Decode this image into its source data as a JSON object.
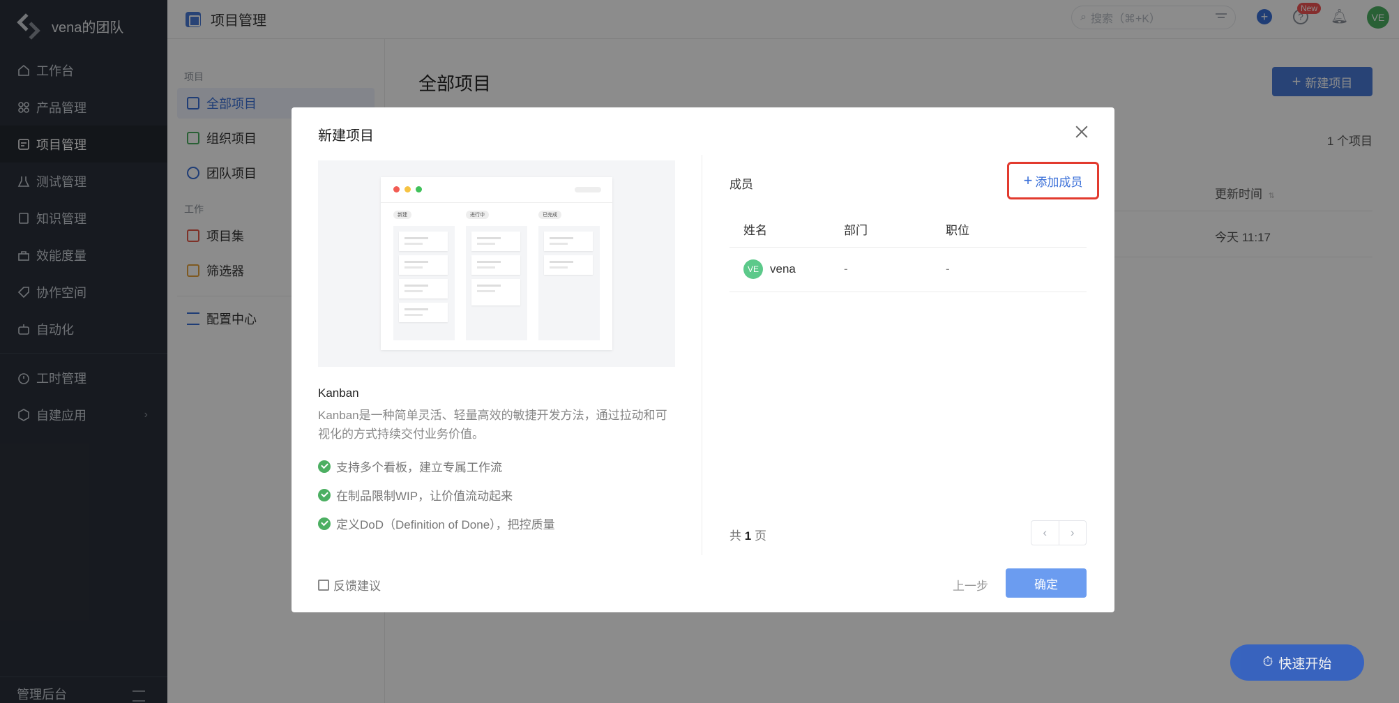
{
  "brand": {
    "name": "vena的团队"
  },
  "sidebar": {
    "items": [
      {
        "label": "工作台",
        "icon": "home-icon"
      },
      {
        "label": "产品管理",
        "icon": "grid-icon"
      },
      {
        "label": "项目管理",
        "icon": "project-icon",
        "active": true
      },
      {
        "label": "测试管理",
        "icon": "flask-icon"
      },
      {
        "label": "知识管理",
        "icon": "book-icon"
      },
      {
        "label": "效能度量",
        "icon": "chart-icon"
      },
      {
        "label": "协作空间",
        "icon": "tag-icon"
      },
      {
        "label": "自动化",
        "icon": "robot-icon"
      }
    ],
    "items2": [
      {
        "label": "工时管理",
        "icon": "timer-icon"
      },
      {
        "label": "自建应用",
        "icon": "cube-icon"
      }
    ],
    "bottom_label": "管理后台"
  },
  "topbar": {
    "title": "项目管理",
    "search_placeholder": "搜索（⌘+K）",
    "new_badge": "New",
    "avatar": "VE"
  },
  "subside": {
    "section1": "项目",
    "items1": [
      "全部项目",
      "组织项目",
      "团队项目"
    ],
    "section2": "工作",
    "items2": [
      "项目集",
      "筛选器"
    ],
    "config": "配置中心"
  },
  "main": {
    "title": "全部项目",
    "new_button": "新建项目",
    "count": "1 个项目",
    "col_update": "更新时间",
    "update_value": "今天 11:17"
  },
  "quick_start": "快速开始",
  "modal": {
    "title": "新建项目",
    "preview_tags": [
      "新建",
      "进行中",
      "已完成"
    ],
    "template_name": "Kanban",
    "template_desc": "Kanban是一种简单灵活、轻量高效的敏捷开发方法，通过拉动和可视化的方式持续交付业务价值。",
    "features": [
      "支持多个看板，建立专属工作流",
      "在制品限制WIP，让价值流动起来",
      "定义DoD（Definition of Done），把控质量"
    ],
    "members_label": "成员",
    "add_member": "添加成员",
    "columns": [
      "姓名",
      "部门",
      "职位"
    ],
    "members": [
      {
        "avatar": "VE",
        "name": "vena",
        "dept": "-",
        "position": "-"
      }
    ],
    "pager_prefix": "共",
    "pager_num": "1",
    "pager_suffix": "页",
    "feedback": "反馈建议",
    "prev": "上一步",
    "ok": "确定"
  },
  "colors": {
    "accent": "#4a7bd8",
    "highlight": "#e23a2e",
    "success": "#4caf62"
  }
}
